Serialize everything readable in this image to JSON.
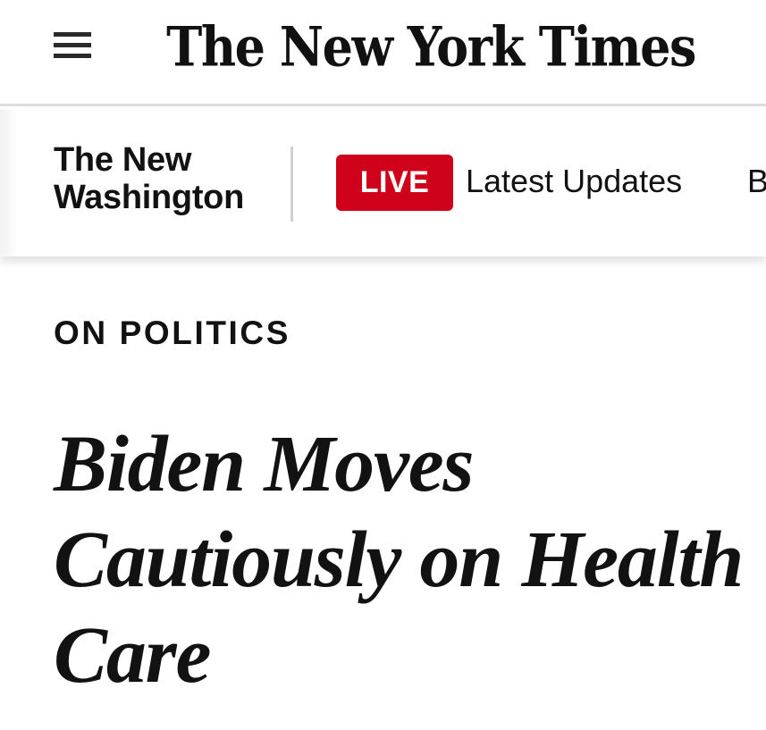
{
  "header": {
    "menu_icon": "hamburger-menu-icon",
    "logo_text": "The New York Times"
  },
  "subnav": {
    "section_title_line1": "The New",
    "section_title_line2": "Washington",
    "live_label": "LIVE",
    "live_color": "#d0021b",
    "latest_updates": "Latest Updates",
    "next_item_partial": "B"
  },
  "article": {
    "kicker": "ON POLITICS",
    "headline": "Biden Moves Cautiously on Health Care"
  }
}
